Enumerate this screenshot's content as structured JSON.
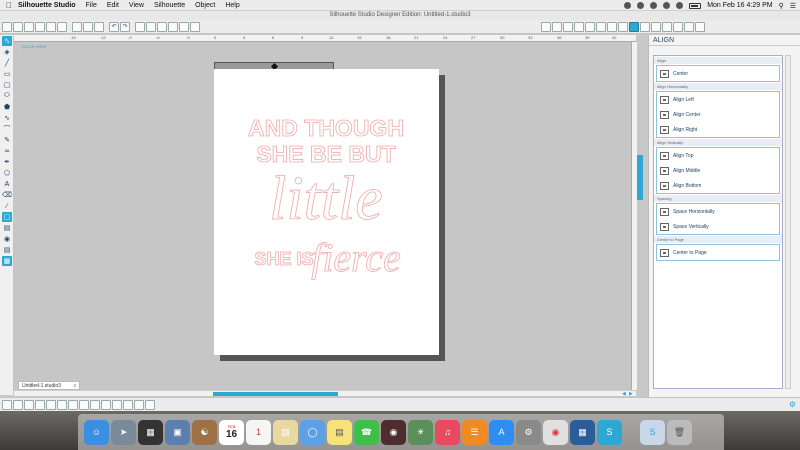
{
  "menubar": {
    "app_name": "Silhouette Studio",
    "items": [
      "File",
      "Edit",
      "View",
      "Silhouette",
      "Object",
      "Help"
    ],
    "clock": "Mon Feb 16  4:29 PM"
  },
  "window": {
    "title": "Silhouette Studio Designer Edition: Untitled-1.studio3"
  },
  "canvas": {
    "quick_view": "QUICK VIEW",
    "ruler_labels": [
      "-15",
      "-12",
      "-9",
      "-6",
      "-3",
      "0",
      "3",
      "6",
      "9",
      "12",
      "15",
      "18",
      "21",
      "24",
      "27",
      "30",
      "33",
      "36",
      "39",
      "42"
    ],
    "design_text": {
      "line1": "AND THOUGH",
      "line2": "SHE BE BUT",
      "line3": "little",
      "line4": "SHE IS",
      "line5": "fierce"
    },
    "doc_tab": "Untitled-1.studio3",
    "doc_tab_close": "x"
  },
  "panel": {
    "title": "ALIGN",
    "sections": [
      {
        "header": "Align",
        "buttons": [
          "Center"
        ]
      },
      {
        "header": "Align Horizontally",
        "buttons": [
          "Align Left",
          "Align Center",
          "Align Right"
        ]
      },
      {
        "header": "Align Vertically",
        "buttons": [
          "Align Top",
          "Align Middle",
          "Align Bottom"
        ]
      },
      {
        "header": "Spacing",
        "buttons": [
          "Space Horizontally",
          "Space Vertically"
        ]
      },
      {
        "header": "Center to Page",
        "buttons": [
          "Center to Page"
        ]
      }
    ]
  },
  "dock": {
    "calendar_month": "FEB",
    "calendar_day": "16",
    "badge": "1"
  },
  "colors": {
    "accent": "#2ea7d3",
    "design_stroke": "#f0a8a8"
  }
}
